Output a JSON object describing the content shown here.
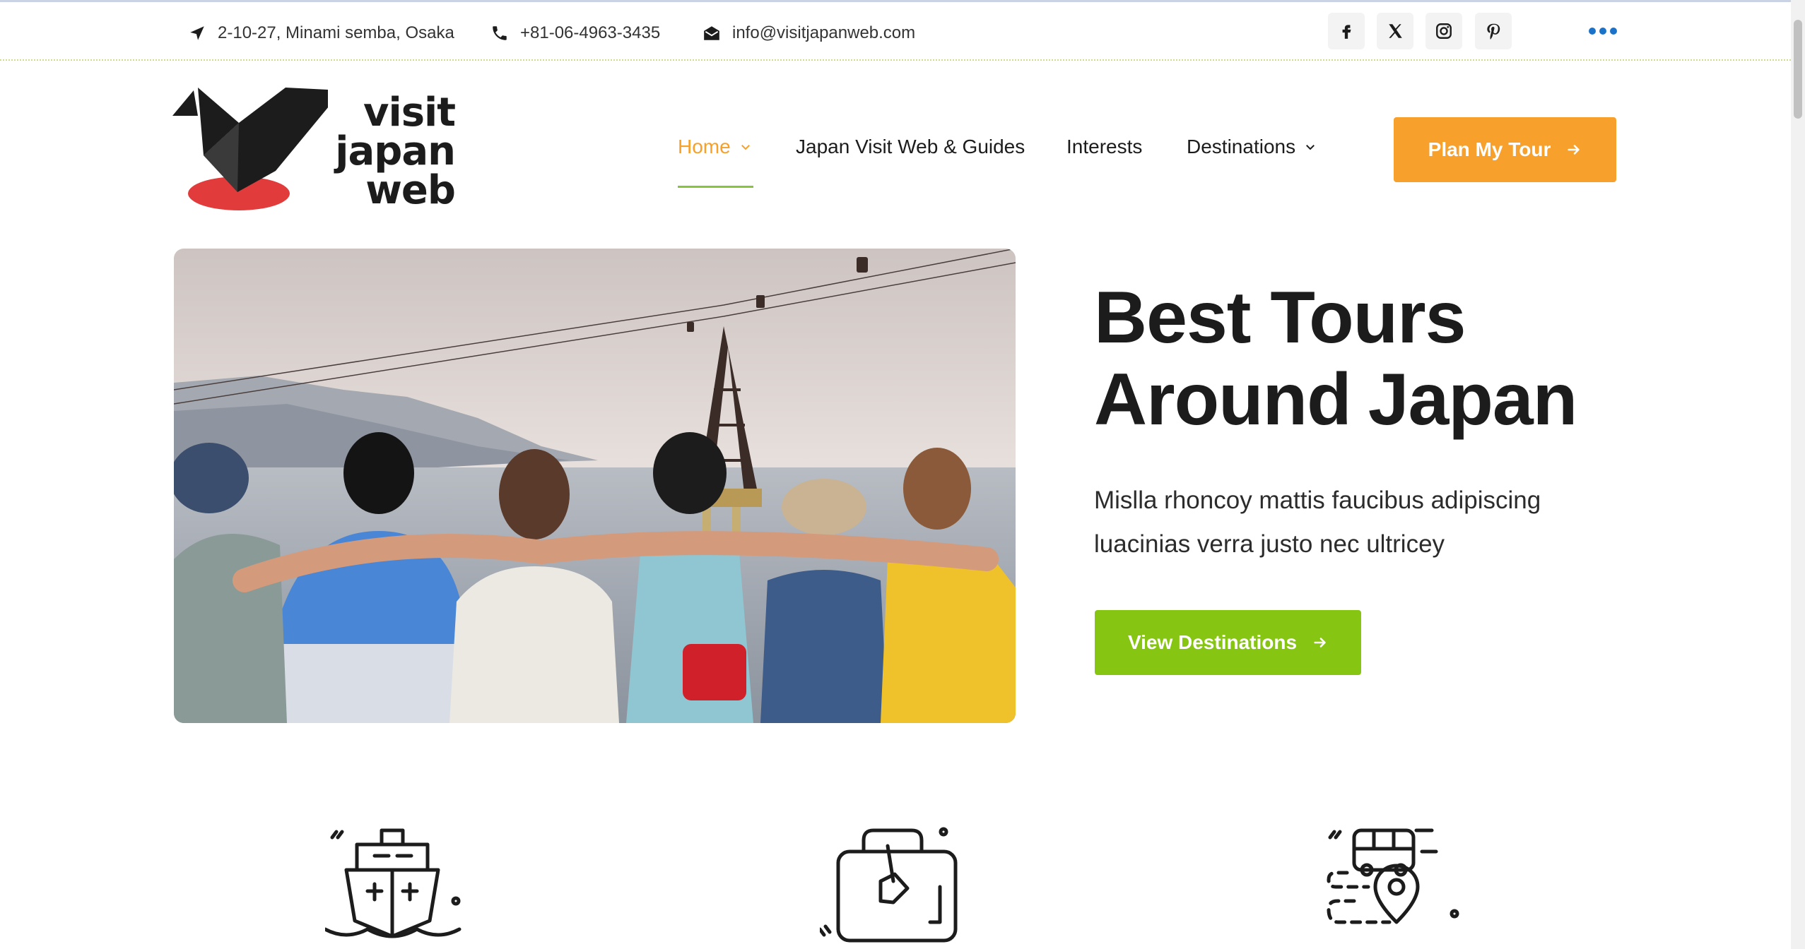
{
  "topbar": {
    "address": "2-10-27, Minami semba, Osaka",
    "phone": "+81-06-4963-3435",
    "email": "info@visitjapanweb.com",
    "address_icon": "location-arrow-icon",
    "phone_icon": "phone-icon",
    "email_icon": "envelope-open-icon",
    "social": [
      "facebook-icon",
      "x-twitter-icon",
      "instagram-icon",
      "pinterest-icon"
    ],
    "more_icon": "ellipsis-icon"
  },
  "logo": {
    "line1": "visit",
    "line2": "japan",
    "line3": "web"
  },
  "nav": {
    "items": [
      {
        "label": "Home",
        "has_dropdown": true,
        "active": true
      },
      {
        "label": "Japan Visit Web & Guides",
        "has_dropdown": false
      },
      {
        "label": "Interests",
        "has_dropdown": false
      },
      {
        "label": "Destinations",
        "has_dropdown": true
      }
    ],
    "cta_label": "Plan My Tour"
  },
  "hero": {
    "title_line1": "Best Tours",
    "title_line2a": "Around",
    "title_line2b": "Japan",
    "subtitle": "Mislla rhoncoy mattis faucibus adipiscing luacinias verra justo nec ultricey",
    "button_label": "View Destinations",
    "image_description_icon": "group-of-friends-photo"
  },
  "features": [
    "ship-icon",
    "luggage-icon",
    "bus-route-icon"
  ],
  "colors": {
    "accent_orange": "#f8a02c",
    "accent_green": "#86c511",
    "nav_active": "#f7a02a",
    "nav_underline": "#86c53a",
    "logo_red": "#e23b3b",
    "text_dark": "#1c1c1c",
    "highlight_blue": "#dbe9f8",
    "more_dots": "#1a73c9"
  }
}
